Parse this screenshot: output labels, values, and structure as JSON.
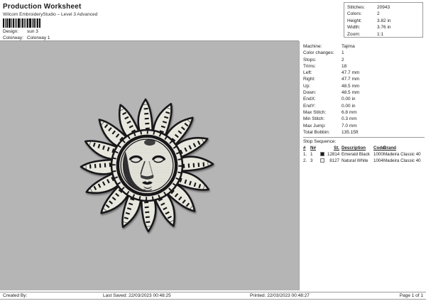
{
  "header": {
    "title": "Production Worksheet",
    "subtitle": "Wilcom EmbroideryStudio – Level 3 Advanced",
    "barcode_icon": "barcode",
    "design_label": "Design:",
    "design_value": "sun 3",
    "colorway_label": "Colorway:",
    "colorway_value": "Colorway 1"
  },
  "summary": {
    "rows": [
      {
        "label": "Stitches:",
        "value": "20943"
      },
      {
        "label": "Colors:",
        "value": "2"
      },
      {
        "label": "Height:",
        "value": "3.82 in"
      },
      {
        "label": "Width:",
        "value": "3.76 in"
      },
      {
        "label": "Zoom:",
        "value": "1:1"
      }
    ]
  },
  "machine_info": {
    "rows": [
      {
        "label": "Machine:",
        "value": "Tajima"
      },
      {
        "label": "Color changes:",
        "value": "1"
      },
      {
        "label": "Stops:",
        "value": "2"
      },
      {
        "label": "Trims:",
        "value": "18"
      },
      {
        "label": "Left:",
        "value": "47.7 mm"
      },
      {
        "label": "Right:",
        "value": "47.7 mm"
      },
      {
        "label": "Up:",
        "value": "48.5 mm"
      },
      {
        "label": "Down:",
        "value": "48.5 mm"
      },
      {
        "label": "EndX:",
        "value": "0.00 in"
      },
      {
        "label": "EndY:",
        "value": "0.00 in"
      },
      {
        "label": "Max Stitch:",
        "value": "6.8 mm"
      },
      {
        "label": "Min Stitch:",
        "value": "0.3 mm"
      },
      {
        "label": "Max Jump:",
        "value": "7.0 mm"
      },
      {
        "label": "Total Bobbin:",
        "value": "135.15ft"
      }
    ]
  },
  "stop_sequence": {
    "title": "Stop Sequence:",
    "columns": [
      "#",
      "N#",
      "St.",
      "Description",
      "Code",
      "Brand"
    ],
    "rows": [
      {
        "num": "1.",
        "n": "1",
        "swatch": "#1a1a1a",
        "st": "12814",
        "description": "Emerald Black",
        "code": "1000",
        "brand": "Madeira Classic 40"
      },
      {
        "num": "2.",
        "n": "3",
        "swatch": "#f1f0e9",
        "st": "8127",
        "description": "Natural White",
        "code": "1004",
        "brand": "Madeira Classic 40"
      }
    ]
  },
  "canvas": {
    "background": "#b5b5b5",
    "design_name": "sun 3",
    "thread_dark": "#17171a",
    "thread_light": "#e9e8df"
  },
  "footer": {
    "created_by": "Created By:",
    "last_saved": "Last Saved: 22/03/2023 00:48:25",
    "printed": "Printed: 22/03/2023 00:48:27",
    "page": "Page 1 of 1"
  }
}
